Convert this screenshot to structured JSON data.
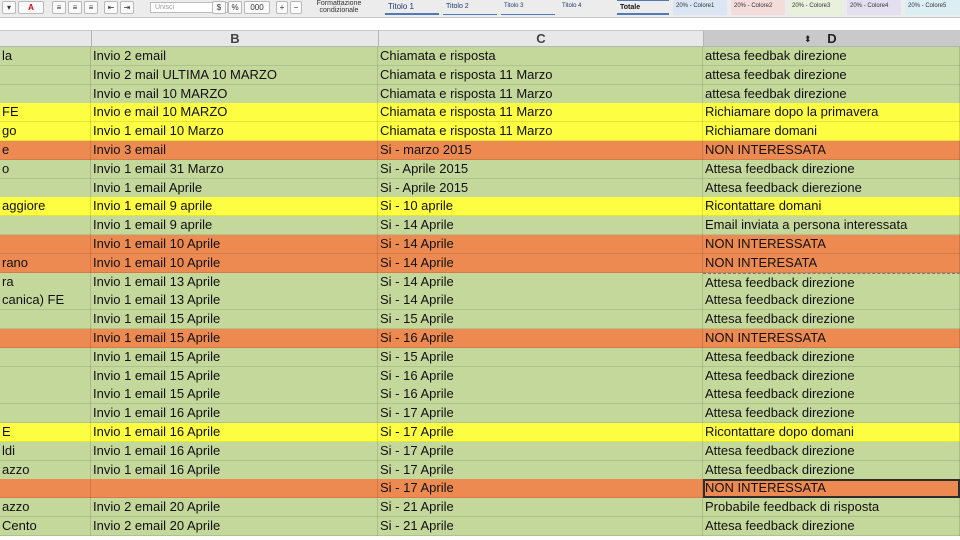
{
  "toolbar": {
    "font_color_label": "A",
    "number_format": "Unisci",
    "percent": "%",
    "thousands": "000",
    "cond_format_line1": "Formattazione",
    "cond_format_line2": "condizionale"
  },
  "styles": [
    "Titolo 1",
    "Titolo 2",
    "Titolo 3",
    "Titolo 4",
    "Totale",
    "20% - Colore1",
    "20% - Colore2",
    "20% - Colore3",
    "20% - Colore4",
    "20% - Colore5"
  ],
  "columns": [
    "B",
    "C",
    "D"
  ],
  "colors": {
    "green": "#c4d89c",
    "yellow": "#fdfd41",
    "orange": "#ed8a51"
  },
  "rows": [
    {
      "a": "la",
      "b": "Invio 2 email",
      "c": "Chiamata e risposta",
      "d": "attesa feedbak direzione",
      "color": "green"
    },
    {
      "a": "",
      "b": "Invio 2 mail ULTIMA 10 MARZO",
      "c": "Chiamata e risposta  11 Marzo",
      "d": "attesa feedbak direzione",
      "color": "green"
    },
    {
      "a": "",
      "b": "Invio e mail 10 MARZO",
      "c": "Chiamata e risposta  11 Marzo",
      "d": "attesa feedbak direzione",
      "color": "green"
    },
    {
      "a": "FE",
      "b": "Invio e mail 10 MARZO",
      "c": "Chiamata e risposta 11 Marzo",
      "d": "Richiamare dopo la primavera",
      "color": "yellow"
    },
    {
      "a": "go",
      "b": "Invio 1 email 10 Marzo",
      "c": "Chiamata e risposta 11 Marzo",
      "d": "Richiamare domani",
      "color": "yellow"
    },
    {
      "a": "e",
      "b": "Invio 3 email",
      "c": "Si - marzo 2015",
      "d": "NON INTERESSATA",
      "color": "orange"
    },
    {
      "a": "o",
      "b": "Invio 1 email 31 Marzo",
      "c": "Si - Aprile 2015",
      "d": "Attesa feedback direzione",
      "color": "green"
    },
    {
      "a": "",
      "b": "Invio 1 email Aprile",
      "c": "Si - Aprile 2015",
      "d": "Attesa feedback dierezione",
      "color": "green"
    },
    {
      "a": "aggiore",
      "b": "Invio 1 email 9 aprile",
      "c": "Si - 10 aprile",
      "d": "Ricontattare domani",
      "color": "yellow"
    },
    {
      "a": "",
      "b": "Invio 1 email 9 aprile",
      "c": "Si - 14 Aprile",
      "d": "Email inviata a persona interessata",
      "color": "green"
    },
    {
      "a": "",
      "b": "Invio 1 email 10 Aprile",
      "c": "Si - 14 Aprile",
      "d": "NON INTERESSATA",
      "color": "orange"
    },
    {
      "a": "rano",
      "b": "Invio 1 email 10 Aprile",
      "c": "Si - 14 Aprile",
      "d": "NON INTERESATA",
      "color": "orange"
    },
    {
      "a": "ra",
      "b": "Invio 1 email 13 Aprile",
      "c": "Si - 14 Aprile",
      "d": "Attesa feedback direzione",
      "color": "green"
    },
    {
      "a": "canica) FE",
      "b": "Invio 1 email 13 Aprile",
      "c": "Si - 14 Aprile",
      "d": "Attesa feedback direzione",
      "color": "green"
    },
    {
      "a": "",
      "b": "Invio 1 email 15 Aprile",
      "c": "Si - 15 Aprile",
      "d": "Attesa feedback direzione",
      "color": "green"
    },
    {
      "a": "",
      "b": "Invio 1 email 15 Aprile",
      "c": "Si - 16 Aprile",
      "d": "NON INTERESSATA",
      "color": "orange"
    },
    {
      "a": "",
      "b": "Invio 1 email 15 Aprile",
      "c": "Si - 15 Aprile",
      "d": "Attesa feedback direzione",
      "color": "green"
    },
    {
      "a": "",
      "b": "Invio 1 email 15 Aprile",
      "c": "Si - 16 Aprile",
      "d": "Attesa feedback direzione",
      "color": "green"
    },
    {
      "a": "",
      "b": "Invio 1 email 15 Aprile",
      "c": "Si - 16 Aprile",
      "d": "Attesa feedback direzione",
      "color": "green"
    },
    {
      "a": "",
      "b": "Invio 1 email 16 Aprile",
      "c": "Si - 17 Aprile",
      "d": "Attesa feedback direzione",
      "color": "green"
    },
    {
      "a": "E",
      "b": "Invio 1 email 16 Aprile",
      "c": "Si - 17 Aprile",
      "d": "Ricontattare dopo domani",
      "color": "yellow"
    },
    {
      "a": "ldi",
      "b": "Invio 1 email 16 Aprile",
      "c": "Si - 17 Aprile",
      "d": "Attesa feedback direzione",
      "color": "green"
    },
    {
      "a": "azzo",
      "b": "Invio 1 email 16 Aprile",
      "c": "Si - 17 Aprile",
      "d": "Attesa feedback direzione",
      "color": "green"
    },
    {
      "a": "",
      "b": "",
      "c": "Si - 17 Aprile",
      "d": "NON INTERESSATA",
      "color": "orange"
    },
    {
      "a": "azzo",
      "b": "Invio 2 email 20 Aprile",
      "c": "Si - 21 Aprile",
      "d": "Probabile feedback di risposta",
      "color": "green"
    },
    {
      "a": " Cento",
      "b": "Invio 2 email 20 Aprile",
      "c": "Si - 21 Aprile",
      "d": "Attesa feedback direzione",
      "color": "green"
    }
  ]
}
